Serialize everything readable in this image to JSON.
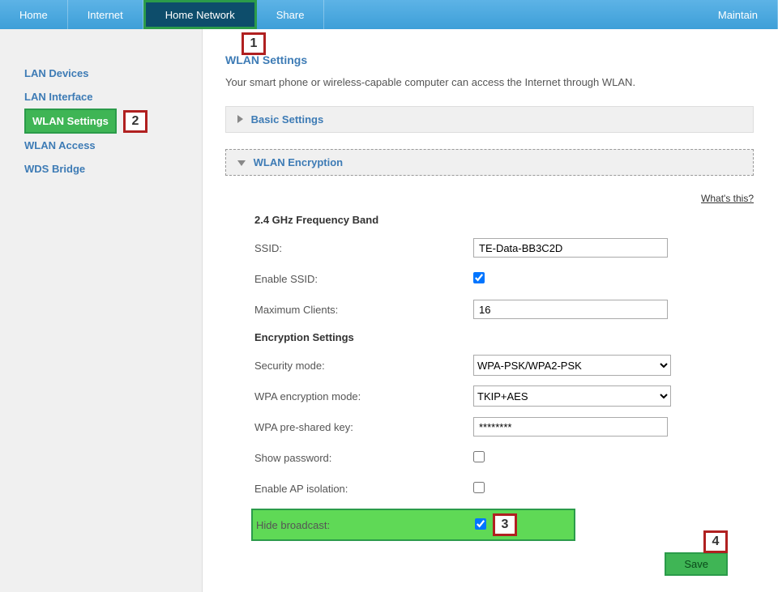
{
  "nav": {
    "home": "Home",
    "internet": "Internet",
    "home_network": "Home Network",
    "share": "Share",
    "maintain": "Maintain"
  },
  "sidebar": {
    "items": [
      {
        "label": "LAN Devices"
      },
      {
        "label": "LAN Interface"
      },
      {
        "label": "WLAN Settings"
      },
      {
        "label": "WLAN Access"
      },
      {
        "label": "WDS Bridge"
      }
    ]
  },
  "page": {
    "title": "WLAN Settings",
    "desc": "Your smart phone or wireless-capable computer can access the Internet through WLAN.",
    "whats": "What's this?"
  },
  "sections": {
    "basic": "Basic Settings",
    "encryption": "WLAN Encryption"
  },
  "form": {
    "band_title": "2.4 GHz Frequency Band",
    "ssid_label": "SSID:",
    "ssid_value": "TE-Data-BB3C2D",
    "enable_ssid_label": "Enable SSID:",
    "max_clients_label": "Maximum Clients:",
    "max_clients_value": "16",
    "enc_title": "Encryption Settings",
    "sec_mode_label": "Security mode:",
    "sec_mode_value": "WPA-PSK/WPA2-PSK",
    "wpa_mode_label": "WPA encryption mode:",
    "wpa_mode_value": "TKIP+AES",
    "psk_label": "WPA pre-shared key:",
    "psk_value": "********",
    "show_pw_label": "Show password:",
    "ap_iso_label": "Enable AP isolation:",
    "hide_bc_label": "Hide broadcast:"
  },
  "callouts": {
    "c1": "1",
    "c2": "2",
    "c3": "3",
    "c4": "4"
  },
  "buttons": {
    "save": "Save"
  }
}
